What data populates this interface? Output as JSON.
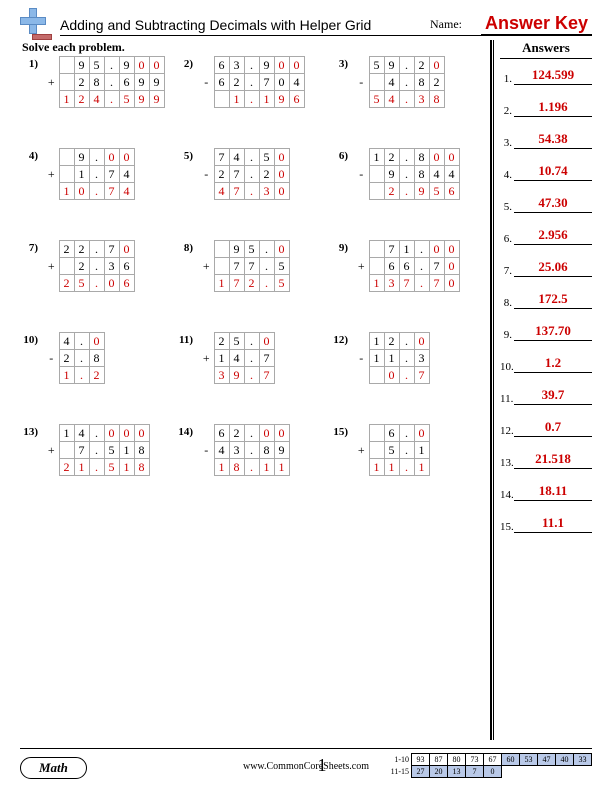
{
  "header": {
    "title": "Adding and Subtracting Decimals with Helper Grid",
    "name_label": "Name:",
    "answerkey": "Answer Key"
  },
  "instruction": "Solve each problem.",
  "answers_header": "Answers",
  "answers": [
    "124.599",
    "1.196",
    "54.38",
    "10.74",
    "47.30",
    "2.956",
    "25.06",
    "172.5",
    "137.70",
    "1.2",
    "39.7",
    "0.7",
    "21.518",
    "18.11",
    "11.1"
  ],
  "problems": [
    {
      "n": "1",
      "op": "+",
      "a": [
        "9",
        "5",
        ".",
        "9",
        "0",
        "0"
      ],
      "b": [
        "2",
        "8",
        ".",
        "6",
        "9",
        "9"
      ],
      "r": [
        "1",
        "2",
        "4",
        ".",
        "5",
        "9",
        "9"
      ],
      "fill_a": [
        4,
        5
      ],
      "cols": 7,
      "shift": 1
    },
    {
      "n": "2",
      "op": "-",
      "a": [
        "6",
        "3",
        ".",
        "9",
        "0",
        "0"
      ],
      "b": [
        "6",
        "2",
        ".",
        "7",
        "0",
        "4"
      ],
      "r": [
        "",
        "1",
        ".",
        "1",
        "9",
        "6"
      ],
      "fill_a": [
        4,
        5
      ],
      "cols": 6,
      "shift": 0,
      "rshift": 0
    },
    {
      "n": "3",
      "op": "-",
      "a": [
        "5",
        "9",
        ".",
        "2",
        "0"
      ],
      "b": [
        "",
        "4",
        ".",
        "8",
        "2"
      ],
      "r": [
        "5",
        "4",
        ".",
        "3",
        "8"
      ],
      "fill_a": [
        4
      ],
      "cols": 5,
      "shift": 0
    },
    {
      "n": "4",
      "op": "+",
      "a": [
        "9",
        ".",
        "0",
        "0"
      ],
      "b": [
        "1",
        ".",
        "7",
        "4"
      ],
      "r": [
        "1",
        "0",
        ".",
        "7",
        "4"
      ],
      "fill_a": [
        2,
        3
      ],
      "cols": 5,
      "shift": 1
    },
    {
      "n": "5",
      "op": "-",
      "a": [
        "7",
        "4",
        ".",
        "5",
        "0"
      ],
      "b": [
        "2",
        "7",
        ".",
        "2",
        "0"
      ],
      "r": [
        "4",
        "7",
        ".",
        "3",
        "0"
      ],
      "fill_a": [
        4
      ],
      "fill_b": [
        4
      ],
      "cols": 5,
      "shift": 0
    },
    {
      "n": "6",
      "op": "-",
      "a": [
        "1",
        "2",
        ".",
        "8",
        "0",
        "0"
      ],
      "b": [
        "",
        "9",
        ".",
        "8",
        "4",
        "4"
      ],
      "r": [
        "",
        "2",
        ".",
        "9",
        "5",
        "6"
      ],
      "fill_a": [
        4,
        5
      ],
      "cols": 6,
      "shift": 0
    },
    {
      "n": "7",
      "op": "+",
      "a": [
        "2",
        "2",
        ".",
        "7",
        "0"
      ],
      "b": [
        "",
        "2",
        ".",
        "3",
        "6"
      ],
      "r": [
        "2",
        "5",
        ".",
        "0",
        "6"
      ],
      "fill_a": [
        4
      ],
      "cols": 5,
      "shift": 0
    },
    {
      "n": "8",
      "op": "+",
      "a": [
        "",
        "9",
        "5",
        ".",
        "0"
      ],
      "b": [
        "",
        "7",
        "7",
        ".",
        "5"
      ],
      "r": [
        "1",
        "7",
        "2",
        ".",
        "5"
      ],
      "fill_a": [
        4
      ],
      "cols": 5,
      "shift": 0
    },
    {
      "n": "9",
      "op": "+",
      "a": [
        "",
        "7",
        "1",
        ".",
        "0",
        "0"
      ],
      "b": [
        "",
        "6",
        "6",
        ".",
        "7",
        "0"
      ],
      "r": [
        "1",
        "3",
        "7",
        ".",
        "7",
        "0"
      ],
      "fill_a": [
        4,
        5
      ],
      "fill_b": [
        5
      ],
      "cols": 6,
      "shift": 0
    },
    {
      "n": "10",
      "op": "-",
      "a": [
        "4",
        ".",
        "0"
      ],
      "b": [
        "2",
        ".",
        "8"
      ],
      "r": [
        "1",
        ".",
        "2"
      ],
      "fill_a": [
        2
      ],
      "cols": 3,
      "shift": 0
    },
    {
      "n": "11",
      "op": "+",
      "a": [
        "2",
        "5",
        ".",
        "0"
      ],
      "b": [
        "1",
        "4",
        ".",
        "7"
      ],
      "r": [
        "3",
        "9",
        ".",
        "7"
      ],
      "fill_a": [
        3
      ],
      "cols": 4,
      "shift": 0
    },
    {
      "n": "12",
      "op": "-",
      "a": [
        "1",
        "2",
        ".",
        "0"
      ],
      "b": [
        "1",
        "1",
        ".",
        "3"
      ],
      "r": [
        "",
        "0",
        ".",
        "7"
      ],
      "fill_a": [
        3
      ],
      "cols": 4,
      "shift": 0
    },
    {
      "n": "13",
      "op": "+",
      "a": [
        "1",
        "4",
        ".",
        "0",
        "0",
        "0"
      ],
      "b": [
        "",
        "7",
        ".",
        "5",
        "1",
        "8"
      ],
      "r": [
        "2",
        "1",
        ".",
        "5",
        "1",
        "8"
      ],
      "fill_a": [
        3,
        4,
        5
      ],
      "cols": 6,
      "shift": 0
    },
    {
      "n": "14",
      "op": "-",
      "a": [
        "6",
        "2",
        ".",
        "0",
        "0"
      ],
      "b": [
        "4",
        "3",
        ".",
        "8",
        "9"
      ],
      "r": [
        "1",
        "8",
        ".",
        "1",
        "1"
      ],
      "fill_a": [
        3,
        4
      ],
      "cols": 5,
      "shift": 0
    },
    {
      "n": "15",
      "op": "+",
      "a": [
        "",
        "6",
        ".",
        "0"
      ],
      "b": [
        "",
        "5",
        ".",
        "1"
      ],
      "r": [
        "1",
        "1",
        ".",
        "1"
      ],
      "fill_a": [
        3
      ],
      "cols": 4,
      "shift": 0
    }
  ],
  "footer": {
    "pill": "Math",
    "site": "www.CommonCoreSheets.com",
    "pageno": "1",
    "score_rows": {
      "r1_label": "1-10",
      "r1": [
        "93",
        "87",
        "80",
        "73",
        "67",
        "60",
        "53",
        "47",
        "40",
        "33"
      ],
      "r2_label": "11-15",
      "r2": [
        "27",
        "20",
        "13",
        "7",
        "0"
      ]
    }
  }
}
